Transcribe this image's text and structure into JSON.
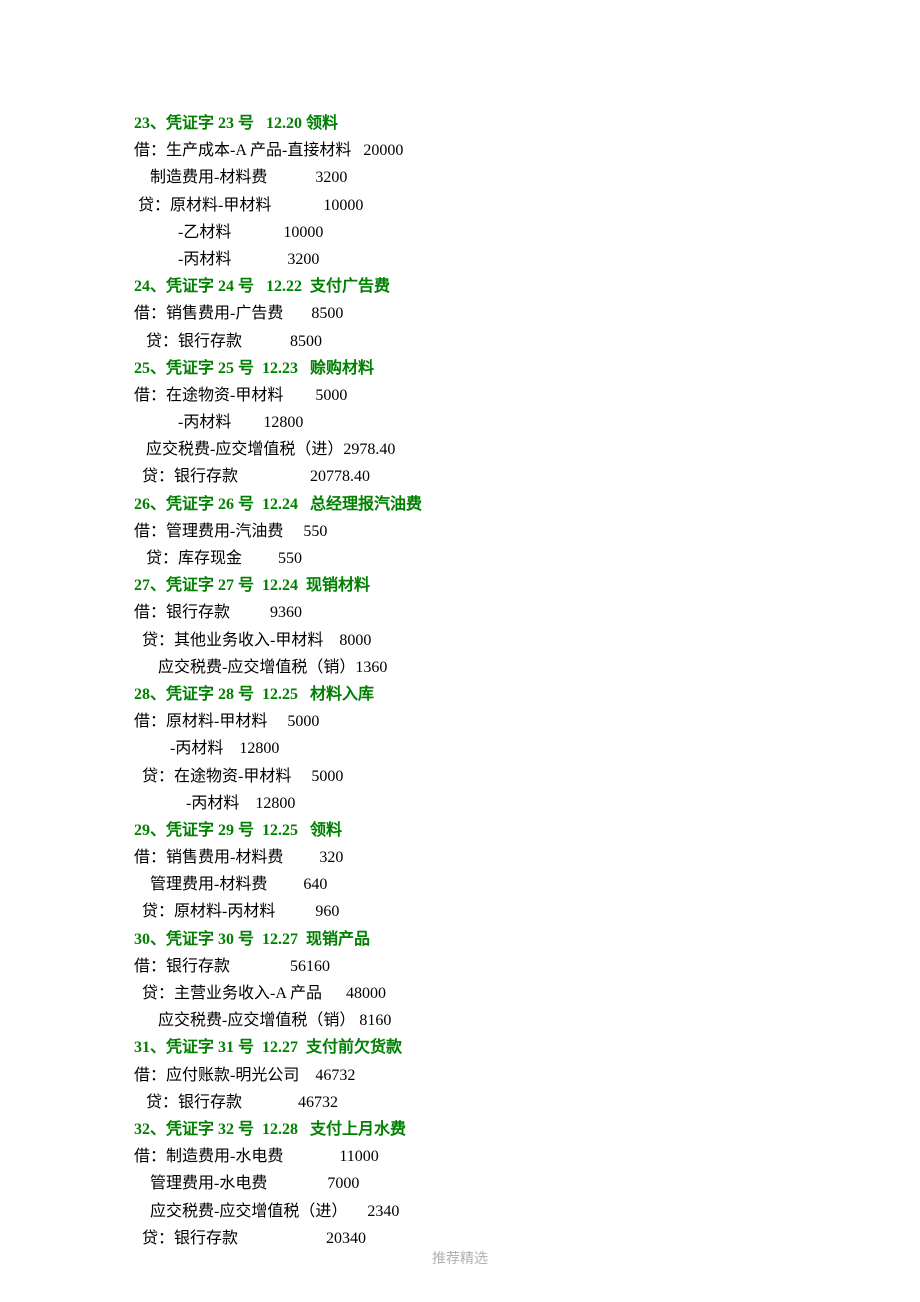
{
  "footer": "推荐精选",
  "entries": [
    {
      "heading": "23、凭证字 23 号   12.20 领料",
      "lines": [
        "借：生产成本-A 产品-直接材料   20000",
        "    制造费用-材料费            3200",
        " 贷：原材料-甲材料             10000",
        "           -乙材料             10000",
        "           -丙材料              3200"
      ]
    },
    {
      "heading": "24、凭证字 24 号   12.22  支付广告费",
      "lines": [
        "借：销售费用-广告费       8500",
        "   贷：银行存款            8500"
      ]
    },
    {
      "heading": "25、凭证字 25 号  12.23   赊购材料",
      "lines": [
        "借：在途物资-甲材料        5000",
        "           -丙材料        12800",
        "   应交税费-应交增值税（进）2978.40",
        "  贷：银行存款                  20778.40"
      ]
    },
    {
      "heading": "26、凭证字 26 号  12.24   总经理报汽油费",
      "lines": [
        "借：管理费用-汽油费     550",
        "   贷：库存现金         550"
      ]
    },
    {
      "heading": "27、凭证字 27 号  12.24  现销材料",
      "lines": [
        "借：银行存款          9360",
        "  贷：其他业务收入-甲材料    8000",
        "      应交税费-应交增值税（销）1360"
      ]
    },
    {
      "heading": "28、凭证字 28 号  12.25   材料入库",
      "lines": [
        "借：原材料-甲材料     5000",
        "         -丙材料    12800",
        "  贷：在途物资-甲材料     5000",
        "             -丙材料    12800"
      ]
    },
    {
      "heading": "29、凭证字 29 号  12.25   领料",
      "lines": [
        "借：销售费用-材料费         320",
        "    管理费用-材料费         640",
        "  贷：原材料-丙材料          960"
      ]
    },
    {
      "heading": "30、凭证字 30 号  12.27  现销产品",
      "lines": [
        "借：银行存款               56160",
        "  贷：主营业务收入-A 产品      48000",
        "      应交税费-应交增值税（销） 8160"
      ]
    },
    {
      "heading": "31、凭证字 31 号  12.27  支付前欠货款",
      "lines": [
        "借：应付账款-明光公司    46732",
        "   贷：银行存款              46732"
      ]
    },
    {
      "heading": "32、凭证字 32 号  12.28   支付上月水费",
      "lines": [
        "借：制造费用-水电费              11000",
        "    管理费用-水电费               7000",
        "    应交税费-应交增值税（进）     2340",
        "  贷：银行存款                      20340"
      ]
    }
  ]
}
